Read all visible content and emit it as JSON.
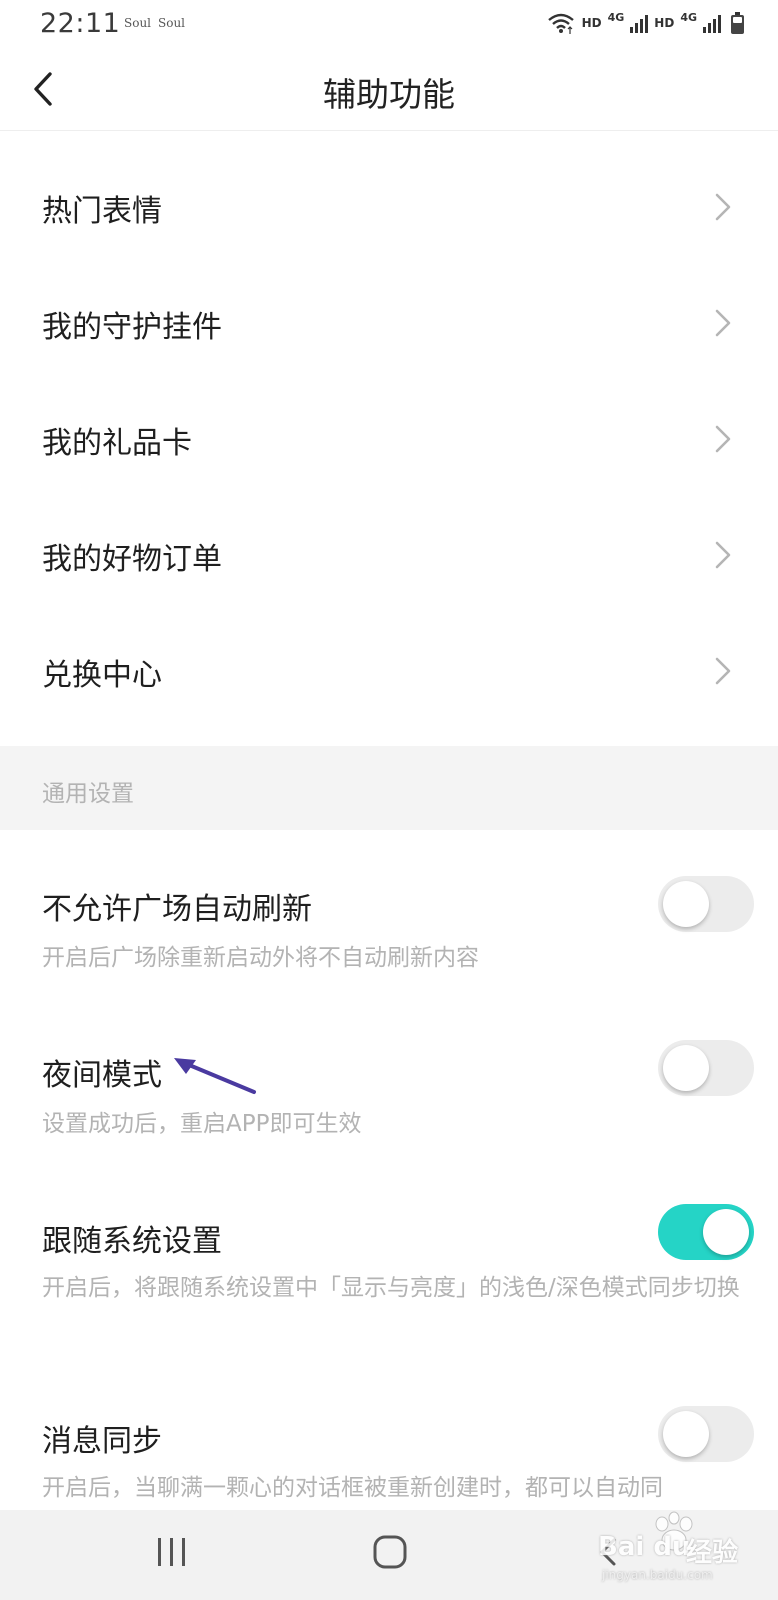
{
  "status_bar": {
    "time": "22:11",
    "app_indicator_1": "Soul",
    "app_indicator_2": "Soul",
    "hd_1": "HD",
    "net_1": "4G",
    "hd_2": "HD",
    "net_2": "4G"
  },
  "header": {
    "title": "辅助功能"
  },
  "menu_items": [
    {
      "label": "热门表情"
    },
    {
      "label": "我的守护挂件"
    },
    {
      "label": "我的礼品卡"
    },
    {
      "label": "我的好物订单"
    },
    {
      "label": "兑换中心"
    }
  ],
  "section": {
    "title": "通用设置"
  },
  "settings": [
    {
      "title": "不允许广场自动刷新",
      "description": "开启后广场除重新启动外将不自动刷新内容",
      "enabled": false
    },
    {
      "title": "夜间模式",
      "description": "设置成功后，重启APP即可生效",
      "enabled": false
    },
    {
      "title": "跟随系统设置",
      "description": "开启后，将跟随系统设置中「显示与亮度」的浅色/深色模式同步切换",
      "enabled": true
    },
    {
      "title": "消息同步",
      "description": "开启后，当聊满一颗心的对话框被重新创建时，都可以自动同",
      "enabled": false
    }
  ],
  "colors": {
    "toggle_on": "#25d4c6",
    "toggle_off": "#ececec",
    "annotation_arrow": "#4a3aa0"
  },
  "watermark": {
    "brand": "Bai du",
    "label": "经验",
    "domain": "jingyan.baidu.com"
  }
}
